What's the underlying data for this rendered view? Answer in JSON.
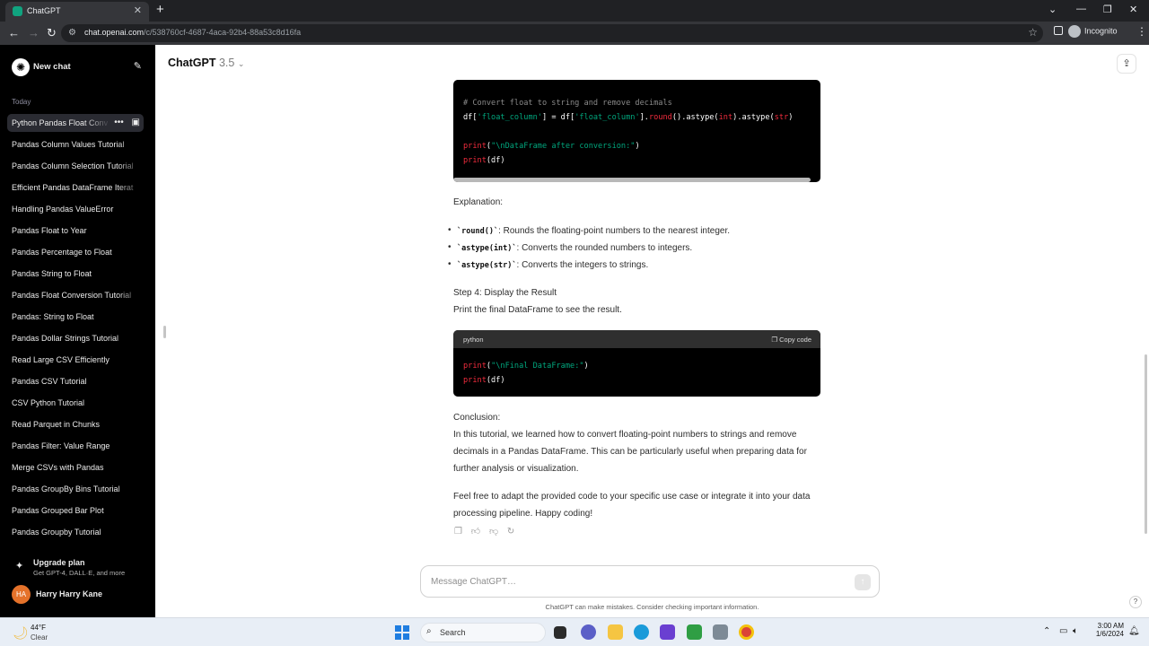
{
  "browser": {
    "tab_title": "ChatGPT",
    "url_domain": "chat.openai.com",
    "url_path": "/c/538760cf-4687-4aca-92b4-88a53c8d16fa",
    "profile_label": "Incognito"
  },
  "sidebar": {
    "new_chat_label": "New chat",
    "section_label": "Today",
    "items": [
      {
        "label": "Python Pandas Float Conv"
      },
      {
        "label": "Pandas Column Values Tutorial"
      },
      {
        "label": "Pandas Column Selection Tutorial"
      },
      {
        "label": "Efficient Pandas DataFrame Iterat"
      },
      {
        "label": "Handling Pandas ValueError"
      },
      {
        "label": "Pandas Float to Year"
      },
      {
        "label": "Pandas Percentage to Float"
      },
      {
        "label": "Pandas String to Float"
      },
      {
        "label": "Pandas Float Conversion Tutorial"
      },
      {
        "label": "Pandas: String to Float"
      },
      {
        "label": "Pandas Dollar Strings Tutorial"
      },
      {
        "label": "Read Large CSV Efficiently"
      },
      {
        "label": "Pandas CSV Tutorial"
      },
      {
        "label": "CSV Python Tutorial"
      },
      {
        "label": "Read Parquet in Chunks"
      },
      {
        "label": "Pandas Filter: Value Range"
      },
      {
        "label": "Merge CSVs with Pandas"
      },
      {
        "label": "Pandas GroupBy Bins Tutorial"
      },
      {
        "label": "Pandas Grouped Bar Plot"
      },
      {
        "label": "Pandas Groupby Tutorial"
      }
    ],
    "upgrade_title": "Upgrade plan",
    "upgrade_subtitle": "Get GPT-4, DALL·E, and more",
    "user_initials": "HA",
    "user_name": "Harry Harry Kane"
  },
  "header": {
    "model_name": "ChatGPT",
    "model_version": "3.5"
  },
  "conversation": {
    "code1": {
      "comment": "# Convert float to string and remove decimals",
      "line2": "df['float_column'] = df['float_column'].round().astype(int).astype(str)",
      "line3": "print(\"\\nDataFrame after conversion:\")",
      "line4": "print(df)"
    },
    "explanation_heading": "Explanation:",
    "bullets": [
      {
        "code": "`round()`",
        "text": ": Rounds the floating-point numbers to the nearest integer."
      },
      {
        "code": "`astype(int)`",
        "text": ": Converts the rounded numbers to integers."
      },
      {
        "code": "`astype(str)`",
        "text": ": Converts the integers to strings."
      }
    ],
    "step4_heading": "Step 4: Display the Result",
    "step4_text": "Print the final DataFrame to see the result.",
    "code2": {
      "language": "python",
      "copy_label": "Copy code",
      "line1": "print(\"\\nFinal DataFrame:\")",
      "line2": "print(df)"
    },
    "conclusion_heading": "Conclusion:",
    "conclusion_text": "In this tutorial, we learned how to convert floating-point numbers to strings and remove decimals in a Pandas DataFrame. This can be particularly useful when preparing data for further analysis or visualization.",
    "closing_text": "Feel free to adapt the provided code to your specific use case or integrate it into your data processing pipeline. Happy coding!"
  },
  "composer": {
    "placeholder": "Message ChatGPT…",
    "disclaimer": "ChatGPT can make mistakes. Consider checking important information."
  },
  "taskbar": {
    "temperature": "44°F",
    "condition": "Clear",
    "search_label": "Search",
    "time": "3:00 AM",
    "date": "1/6/2024"
  },
  "colors": {
    "sidebar_bg": "#000000",
    "accent": "#10a37f",
    "code_string": "#00a67d",
    "code_function": "#f22c3d"
  }
}
